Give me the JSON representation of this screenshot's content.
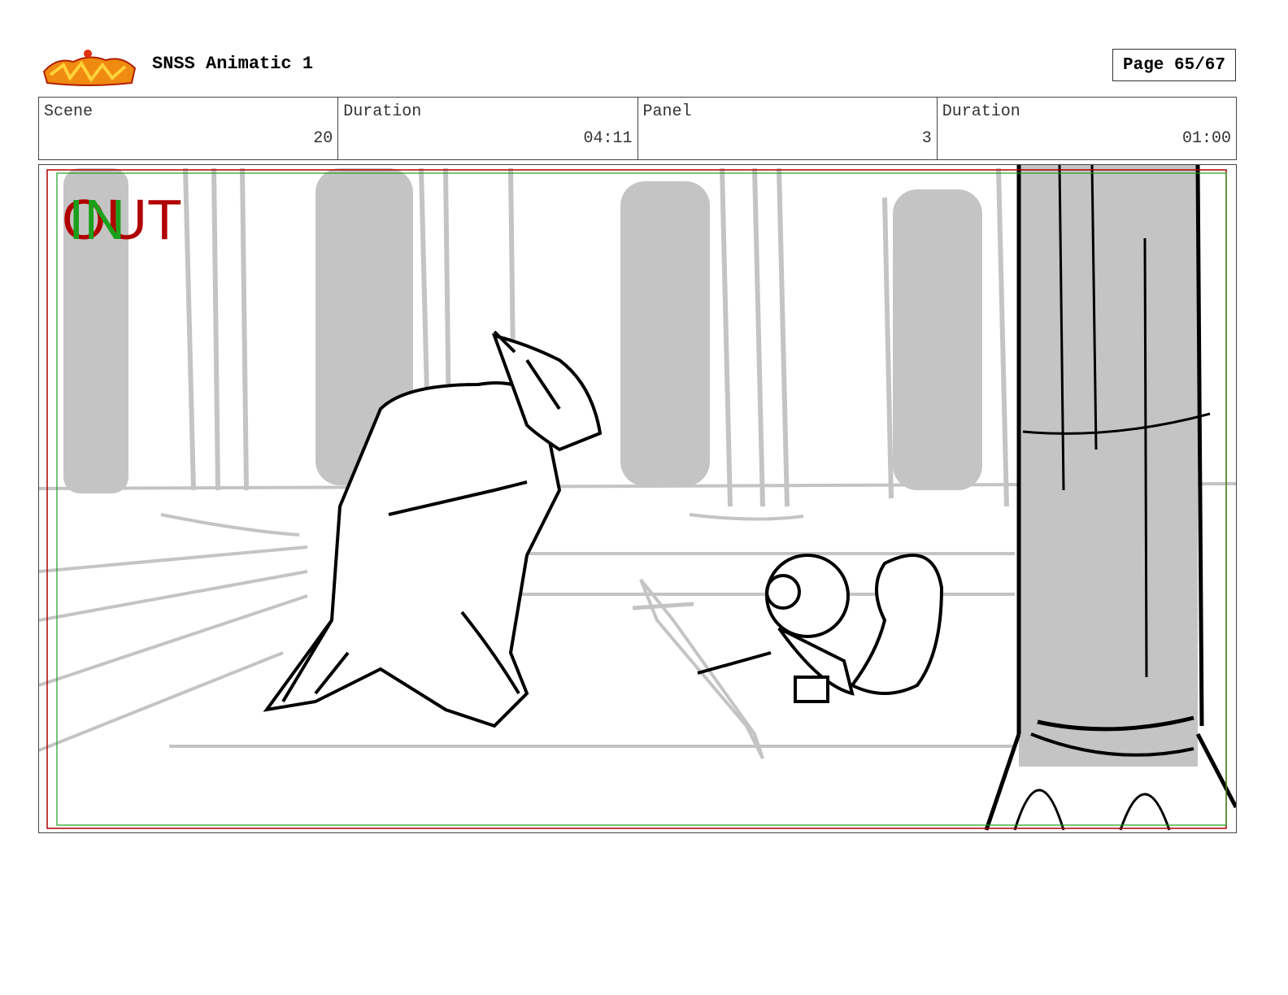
{
  "header": {
    "logo_icon": "sir-fluff-n-stuff-logo",
    "title": "SNSS Animatic 1",
    "page": "Page 65/67"
  },
  "info": {
    "scene_label": "Scene",
    "scene_value": "20",
    "duration_label": "Duration",
    "duration_value": "04:11",
    "panel_label": "Panel",
    "panel_value": "3",
    "panel_duration_label": "Duration",
    "panel_duration_value": "01:00"
  },
  "panel": {
    "in_label": "IN",
    "out_label": "OUT",
    "safe_frame_color": "#b00000",
    "action_safe_color": "#1aa01a"
  }
}
